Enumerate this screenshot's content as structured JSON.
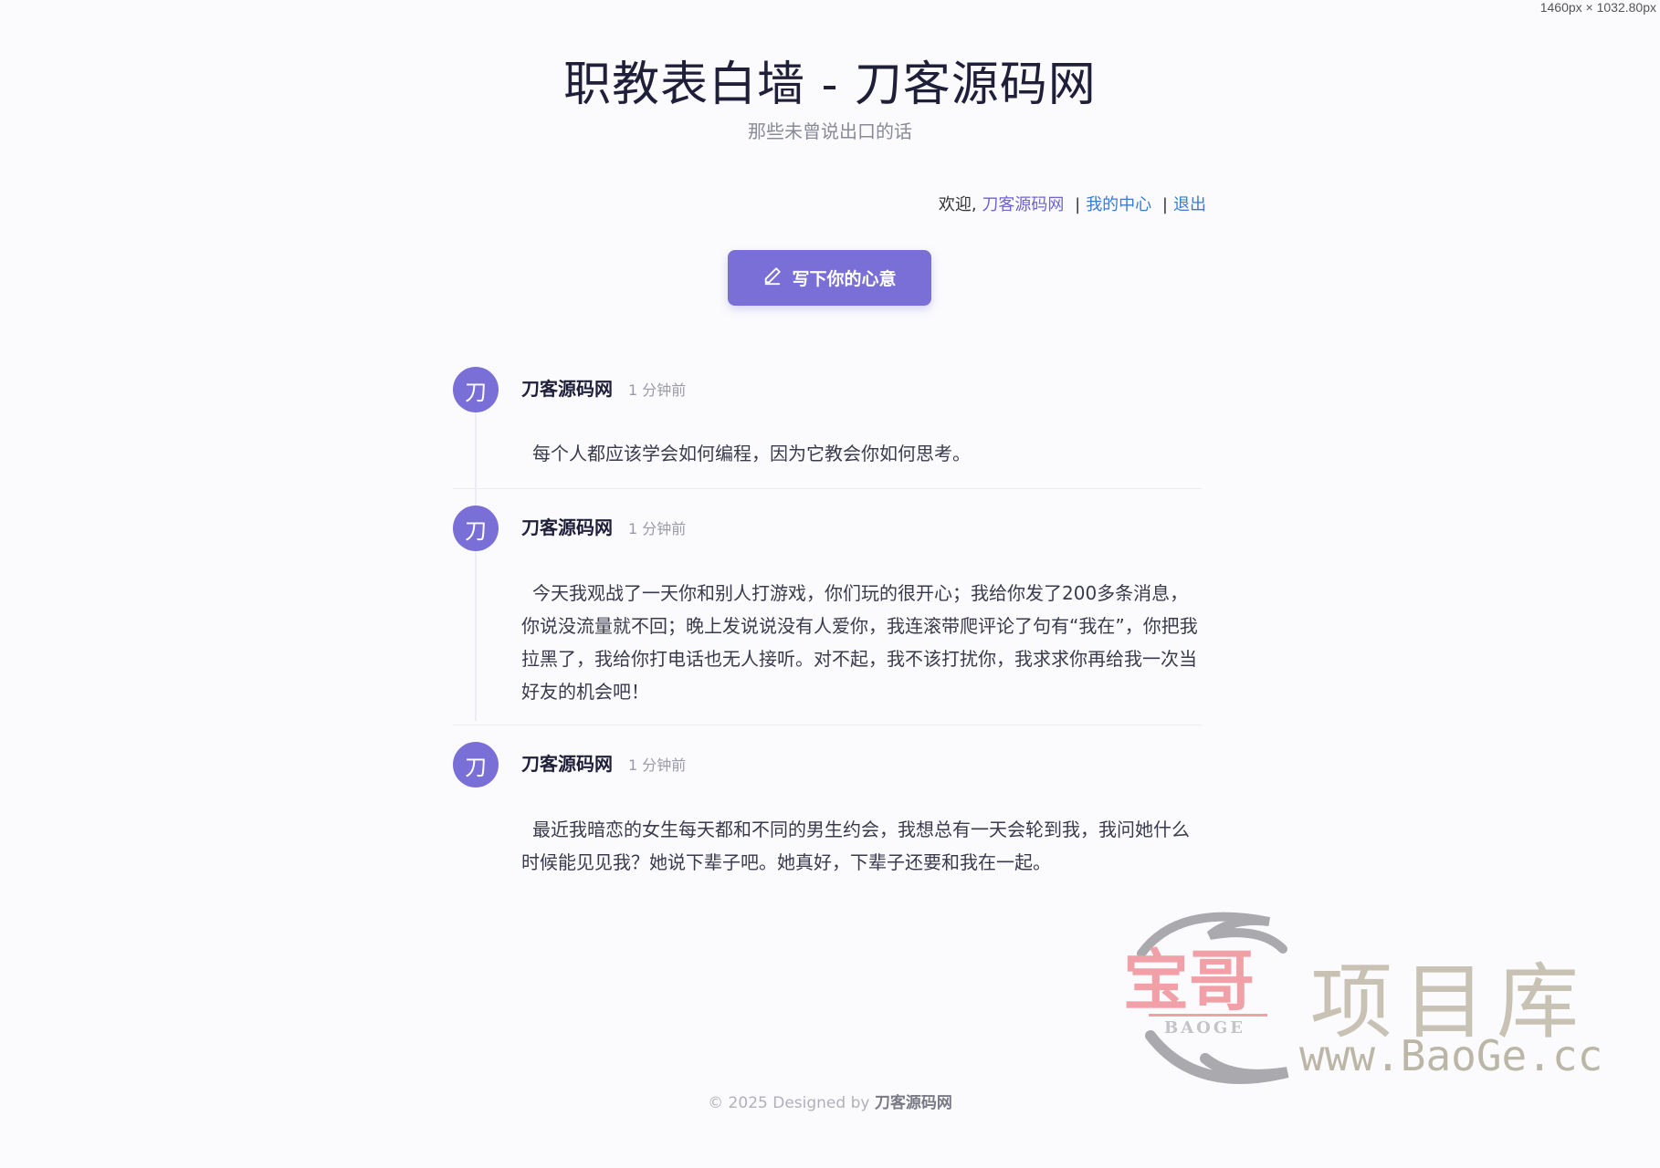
{
  "viewport_label": "1460px × 1032.80px",
  "header": {
    "title": "职教表白墙 - 刀客源码网",
    "subtitle": "那些未曾说出口的话"
  },
  "user_bar": {
    "welcome": "欢迎,",
    "username": "刀客源码网",
    "separator": "|",
    "my_center": "我的中心",
    "logout": "退出"
  },
  "write_button": {
    "label": "写下你的心意",
    "icon": "pencil-icon"
  },
  "posts": [
    {
      "avatar": "刀",
      "author": "刀客源码网",
      "time": "1 分钟前",
      "content": "每个人都应该学会如何编程，因为它教会你如何思考。"
    },
    {
      "avatar": "刀",
      "author": "刀客源码网",
      "time": "1 分钟前",
      "content": "今天我观战了一天你和别人打游戏，你们玩的很开心；我给你发了200多条消息，你说没流量就不回；晚上发说说没有人爱你，我连滚带爬评论了句有“我在”，你把我拉黑了，我给你打电话也无人接听。对不起，我不该打扰你，我求求你再给我一次当好友的机会吧！"
    },
    {
      "avatar": "刀",
      "author": "刀客源码网",
      "time": "1 分钟前",
      "content": "最近我暗恋的女生每天都和不同的男生约会，我想总有一天会轮到我，我问她什么时候能见见我？她说下辈子吧。她真好，下辈子还要和我在一起。"
    }
  ],
  "footer": {
    "prefix": "© 2025 Designed by",
    "brand": "刀客源码网"
  },
  "watermark": {
    "logo_text": "宝哥",
    "logo_sub": "BAOGE",
    "title": "项目库",
    "url": "www.BaoGe.cc"
  },
  "colors": {
    "accent": "#7a6fd6",
    "link_blue": "#3a7ad5",
    "background": "#fbfbfd"
  }
}
